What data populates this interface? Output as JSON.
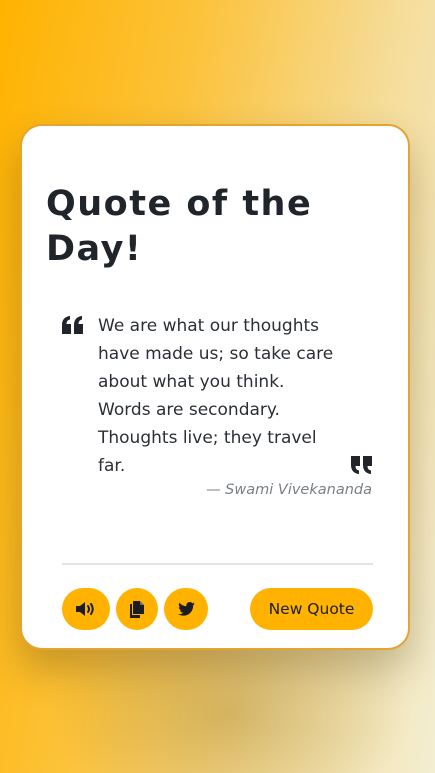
{
  "card": {
    "title": "Quote of the Day!",
    "quote": "We are what our thoughts have made us; so take care about what you think. Words are secondary. Thoughts live; they travel far.",
    "author": "— Swami Vivekananda"
  },
  "actions": {
    "speak_icon": "volume-icon",
    "copy_icon": "copy-icon",
    "tweet_icon": "twitter-icon",
    "new_quote_label": "New Quote"
  },
  "colors": {
    "accent": "#ffb300",
    "card_border": "#e3a431",
    "text_dark": "#20252c",
    "author_gray": "#7a7f86"
  }
}
